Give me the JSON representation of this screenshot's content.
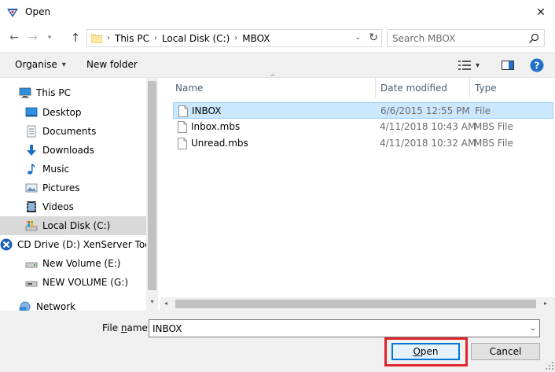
{
  "window": {
    "title": "Open",
    "close_glyph": "✕"
  },
  "navigation": {
    "back_glyph": "←",
    "forward_glyph": "→",
    "recent_glyph": "▾",
    "up_glyph": "↑"
  },
  "address": {
    "crumbs": [
      "This PC",
      "Local Disk (C:)",
      "MBOX"
    ],
    "separator": "›",
    "dropdown_glyph": "⌄",
    "refresh_glyph": "↻"
  },
  "search": {
    "placeholder": "Search MBOX"
  },
  "toolbar": {
    "organise_label": "Organise",
    "organise_arrow": "▾",
    "new_folder_label": "New folder",
    "view_arrow": "▾"
  },
  "sidebar": {
    "items": [
      {
        "label": "This PC",
        "icon": "computer-icon"
      },
      {
        "label": "Desktop",
        "icon": "desktop-icon"
      },
      {
        "label": "Documents",
        "icon": "documents-icon"
      },
      {
        "label": "Downloads",
        "icon": "downloads-icon"
      },
      {
        "label": "Music",
        "icon": "music-icon"
      },
      {
        "label": "Pictures",
        "icon": "pictures-icon"
      },
      {
        "label": "Videos",
        "icon": "videos-icon"
      },
      {
        "label": "Local Disk (C:)",
        "icon": "drive-icon",
        "selected": true
      },
      {
        "label": "CD Drive (D:) XenServer Tools",
        "icon": "cd-drive-icon"
      },
      {
        "label": "New Volume (E:)",
        "icon": "drive-icon"
      },
      {
        "label": "NEW VOLUME (G:)",
        "icon": "drive-icon"
      },
      {
        "label": "Network",
        "icon": "network-icon"
      }
    ],
    "scroll_down_glyph": "▾"
  },
  "file_list": {
    "columns": {
      "name": "Name",
      "date": "Date modified",
      "type": "Type"
    },
    "sort_glyph": "^",
    "files": [
      {
        "name": "INBOX",
        "date": "6/6/2015 12:55 PM",
        "type": "File",
        "selected": true
      },
      {
        "name": "Inbox.mbs",
        "date": "4/11/2018 10:43 AM",
        "type": "MBS File"
      },
      {
        "name": "Unread.mbs",
        "date": "4/11/2018 10:32 AM",
        "type": "MBS File"
      }
    ],
    "scroll_left_glyph": "◂",
    "scroll_right_glyph": "▸"
  },
  "footer": {
    "file_name_label": "File name:",
    "file_name_value": "INBOX",
    "dropdown_glyph": "⌄",
    "open_label": "Open",
    "cancel_label": "Cancel"
  },
  "colors": {
    "selection": "#cce8ff",
    "selection_border": "#99d1ff",
    "nav_selected": "#d9d9d9",
    "highlight": "#e0262d",
    "accent": "#0078d7"
  }
}
